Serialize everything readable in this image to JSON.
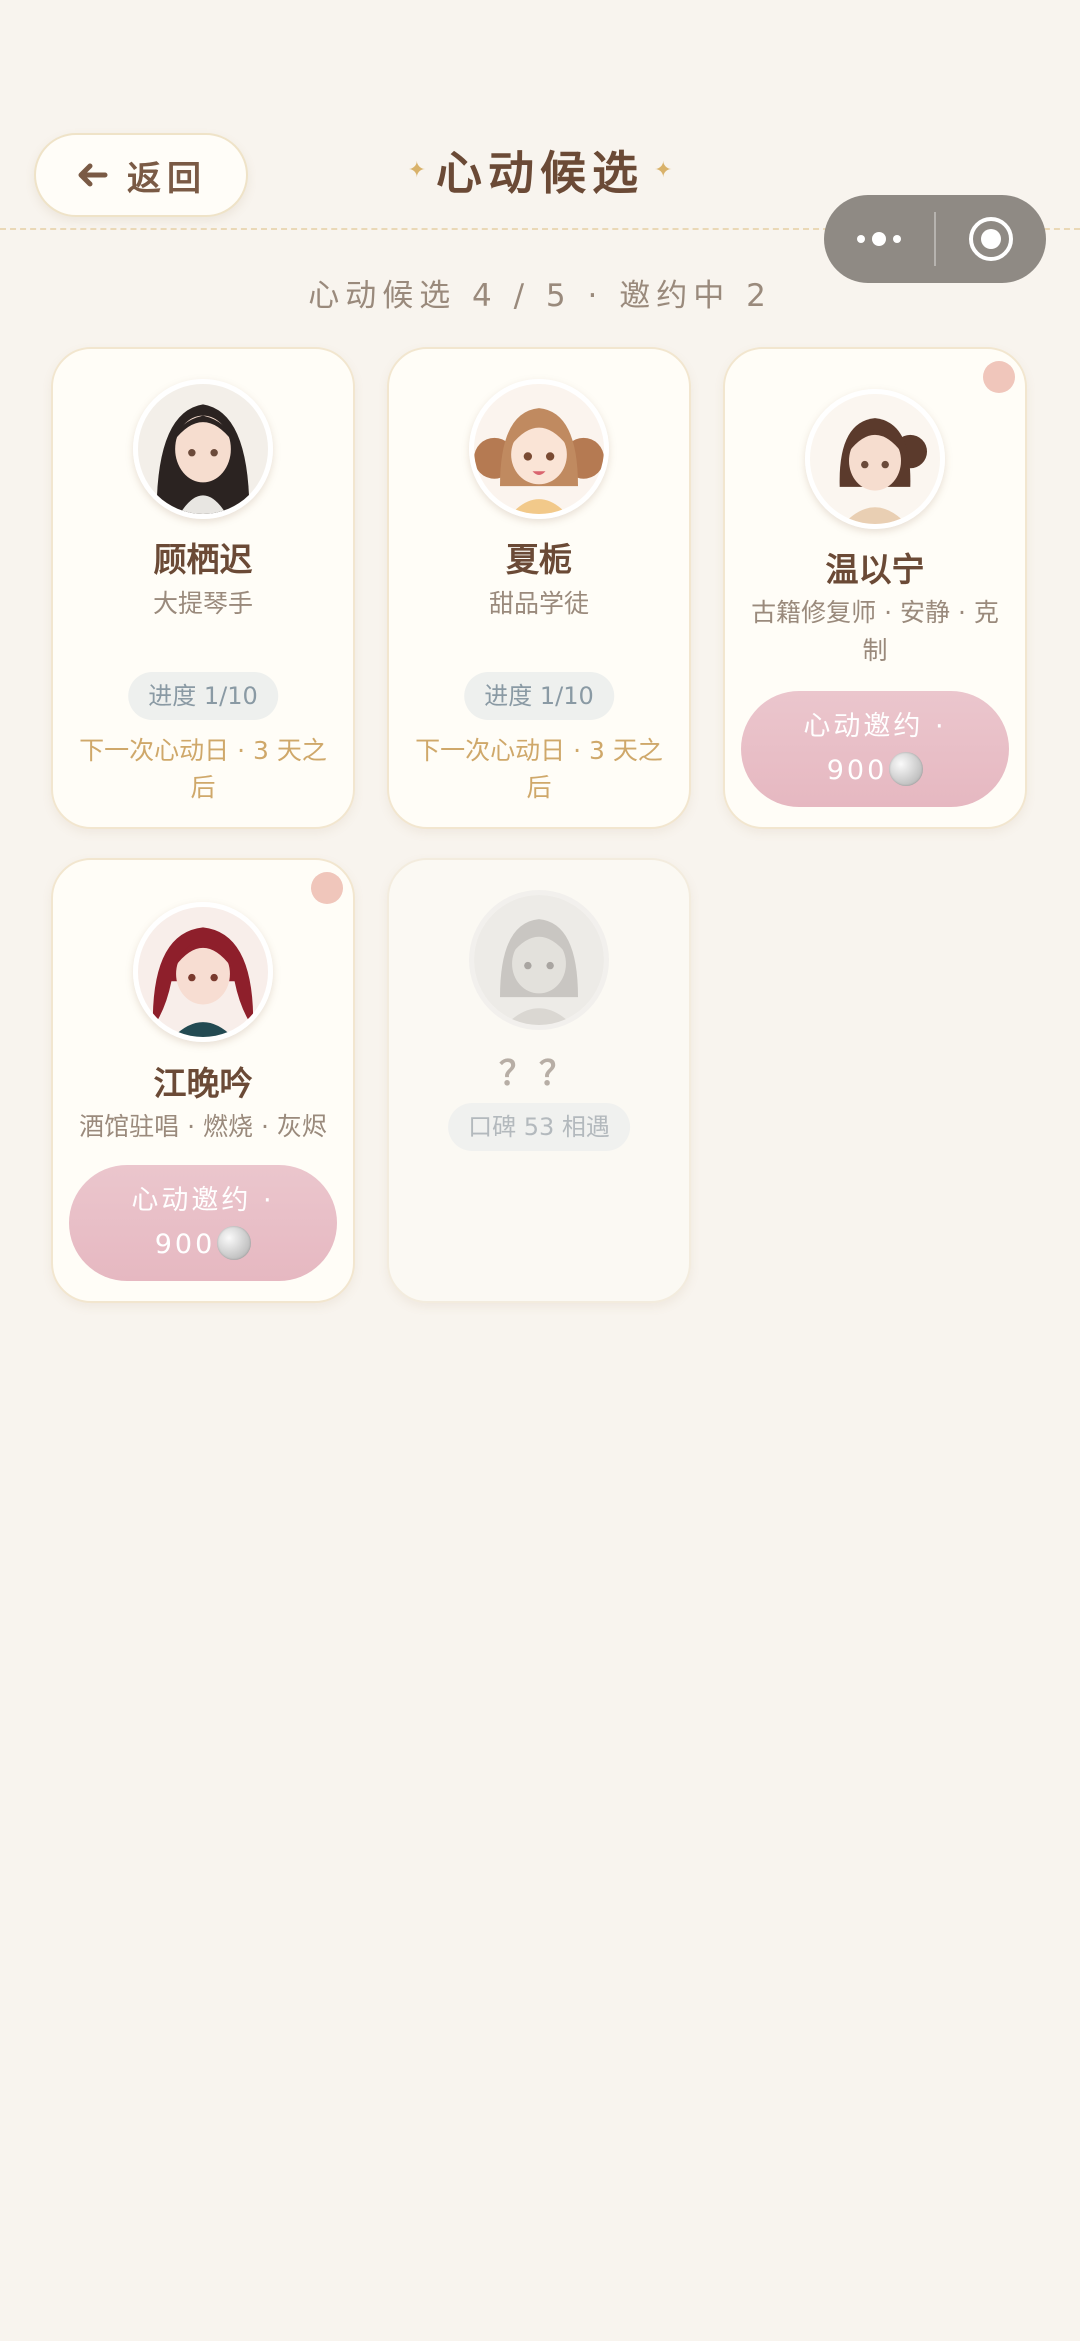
{
  "header": {
    "back_label": "返回",
    "title": "心动候选",
    "sparkle": "✦"
  },
  "summary": "心动候选 4 / 5 · 邀约中 2",
  "capsule": {
    "more_icon": "more-dots-icon",
    "close_icon": "target-circle-icon"
  },
  "characters": [
    {
      "name": "顾栖迟",
      "role": "大提琴手",
      "progress": "进度 1/10",
      "next_date": "下一次心动日 · 3 天之后"
    },
    {
      "name": "夏栀",
      "role": "甜品学徒",
      "progress": "进度 1/10",
      "next_date": "下一次心动日 · 3 天之后"
    },
    {
      "name": "温以宁",
      "role": "古籍修复师 · 安静 · 克制",
      "invite_label": "心动邀约 ·",
      "price": "900"
    },
    {
      "name": "江晚吟",
      "role": "酒馆驻唱 · 燃烧 · 灰烬",
      "invite_label": "心动邀约 ·",
      "price": "900"
    },
    {
      "name": "？？",
      "reputation": "口碑 53 相遇"
    }
  ],
  "colors": {
    "background": "#f8f4ee",
    "card": "#fffdf7",
    "invite": "#e8bfc7",
    "accent_gold": "#cfa86a",
    "title": "#6b4a36"
  }
}
